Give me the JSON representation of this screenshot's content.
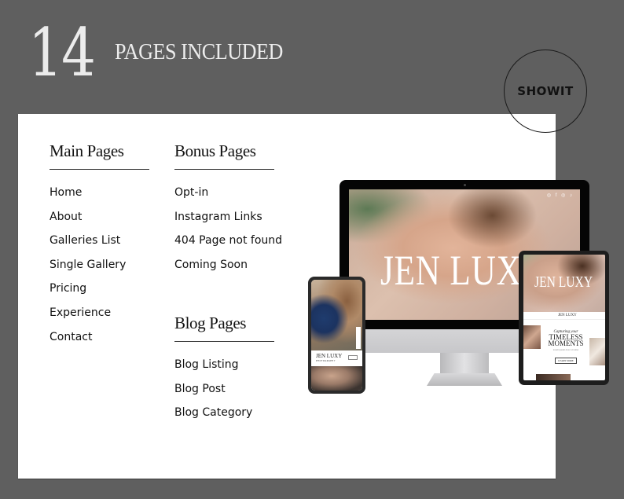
{
  "header": {
    "count": "14",
    "title": "PAGES INCLUDED"
  },
  "badge": {
    "label": "SHOWIT"
  },
  "columns": {
    "main": {
      "heading": "Main Pages",
      "items": [
        "Home",
        "About",
        "Galleries List",
        "Single Gallery",
        "Pricing",
        "Experience",
        "Contact"
      ]
    },
    "bonus": {
      "heading": "Bonus Pages",
      "items": [
        "Opt-in",
        "Instagram Links",
        "404 Page not found",
        "Coming Soon"
      ]
    },
    "blog": {
      "heading": "Blog Pages",
      "items": [
        "Blog Listing",
        "Blog Post",
        "Blog Category"
      ]
    }
  },
  "mockups": {
    "desktop_title": "JEN LUXY",
    "desktop_social": "◎ f ◎ ♪",
    "tablet_title": "JEN LUXY",
    "tablet_logo": "JEN LUXY",
    "tablet_caption_script": "Capturing your",
    "tablet_caption_line1": "TIMELESS",
    "tablet_caption_line2": "MOMENTS",
    "tablet_caption_small": "lorem ipsum dolor sit amet",
    "tablet_button": "LEARN MORE",
    "phone_logo": "JEN LUXY",
    "phone_sub": "PHOTOGRAPHY"
  },
  "colors": {
    "background": "#5f5f5f",
    "panel": "#ffffff",
    "heading_text": "#ececec",
    "body_text": "#111111"
  }
}
